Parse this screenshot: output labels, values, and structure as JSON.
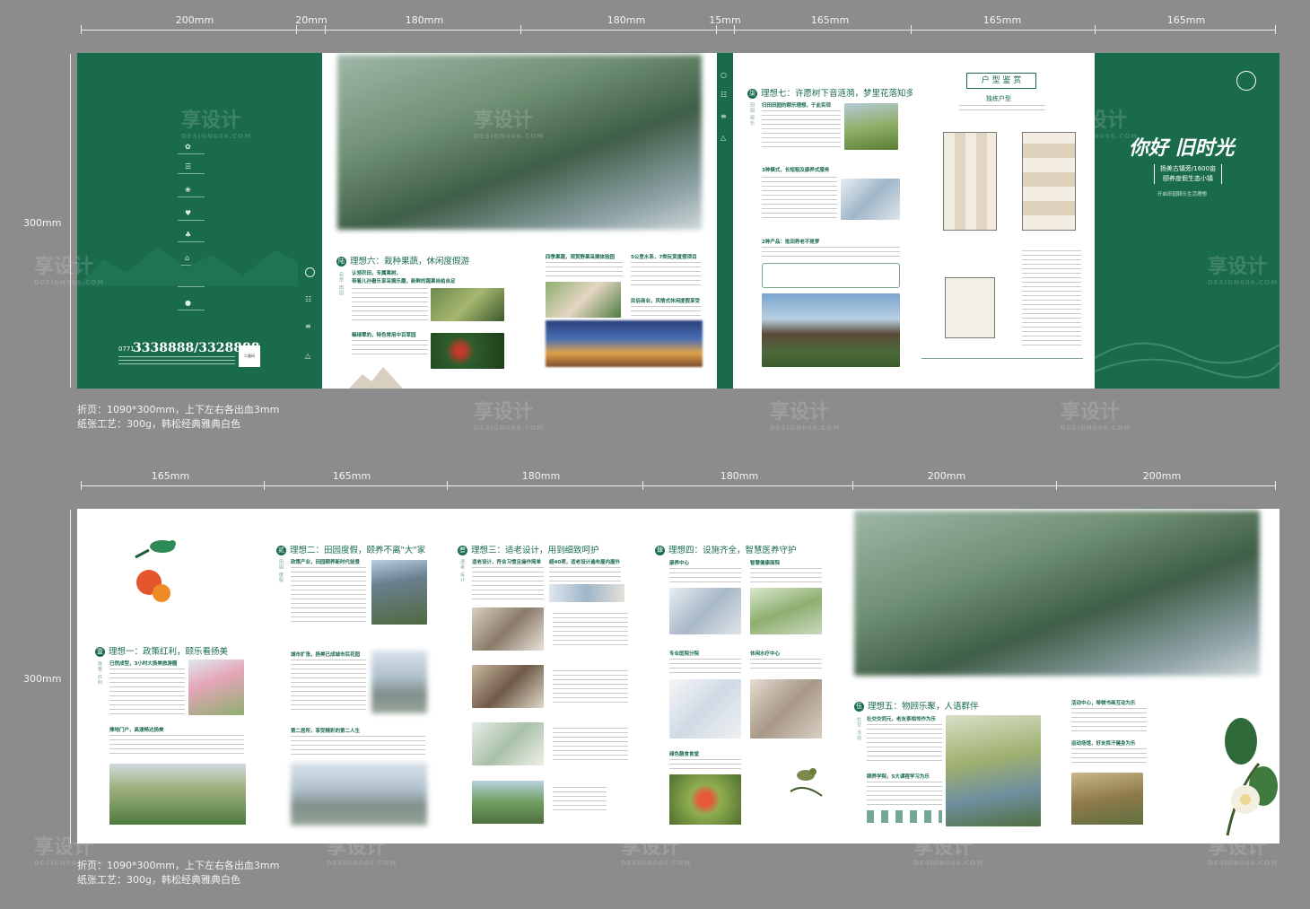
{
  "top_row": {
    "widths": [
      "200mm",
      "20mm",
      "180mm",
      "180mm",
      "15mm",
      "165mm",
      "165mm",
      "165mm"
    ],
    "height": "300mm",
    "note_fold": "折页：1090*300mm，上下左右各出血3mm",
    "note_paper": "纸张工艺：300g，韩松经典雅典白色"
  },
  "bottom_row": {
    "widths": [
      "165mm",
      "165mm",
      "180mm",
      "180mm",
      "200mm",
      "200mm"
    ],
    "height": "300mm",
    "note_fold": "折页：1090*300mm，上下左右各出血3mm",
    "note_paper": "纸张工艺：300g，韩松经典雅典白色"
  },
  "back_cover": {
    "phone": "3338888/3328888",
    "phone_prefix": "0771",
    "qr_label": "二维码"
  },
  "front_cover": {
    "headline": "你好 旧时光",
    "subline_1": "扬美古镇旁/1600亩",
    "subline_2": "颐养度假生态小镇",
    "tagline": "开启田园颐乐生活理想"
  },
  "sections": {
    "ideal6": "理想六：栽种果蔬，休闲度假游",
    "ideal6_sub1": "认领农田，专属果树，",
    "ideal6_sub1b": "带着儿孙看乐享采摘乐趣，新鲜的蔬果自给自足",
    "ideal6_sub2": "嘛绿翠的，特色常用中百草园",
    "ideal6_col2_a": "四季果蔬，观赏野果采摘体验园",
    "ideal6_col2_b": "民俗商业，风情式休闲度假享受",
    "ideal6_col3": "5公里水系，7类玩赏度假项目",
    "ideal7": "理想七：许愿树下音涟漪，梦里花落知多少",
    "ideal7_sub1": "归田田园的颐乐理想，于此实现",
    "ideal7_sub2": "3种模式，长短租及康养式服务",
    "ideal7_sub3": "2种产品：批田养老不是梦",
    "floorplan_title": "户 型 鉴 赏",
    "floorplan_sub": "独栋户型",
    "ideal1": "理想一：政策红利，颐乐看扬美",
    "ideal1_sub1": "已然成型，3小时大扬美旅游圈",
    "ideal1_sub2": "捧地门户，高速畅达扬美",
    "ideal2": "理想二：田园度假，颐养不离\"大\"家",
    "ideal2_sub1": "政策产业，田园颐养新时代前景",
    "ideal2_sub2": "城市扩张，扬美已成城市后花园",
    "ideal2_sub3": "第二居所，享受精彩的第二人生",
    "ideal3": "理想三：适老设计，用到细致呵护",
    "ideal3_sub1": "适老设计，符合习惯且操作简单",
    "ideal3_sub2": "超40项，适老设计遍布屋内屋外",
    "ideal4": "理想四：设施齐全，智慧医养守护",
    "ideal4_sub1": "康养中心",
    "ideal4_sub2": "智慧健康面院",
    "ideal4_sub3": "专业医院分院",
    "ideal4_sub4": "休闲水疗中心",
    "ideal4_sub5": "绿色膳食食堂",
    "ideal5": "理想五：物顾乐聚，人语群伴",
    "ideal5_sub1": "社交交同元，老友茶相邻作为乐",
    "ideal5_sub2": "颐养学院，5大课程学习为乐",
    "ideal5_sub3": "活动中心，琴棋书画互动为乐",
    "ideal5_sub4": "运动场馆，好友挥汗健身为乐"
  },
  "watermark": {
    "cn": "享设计",
    "en": "DESIGN006.COM"
  },
  "colors": {
    "brand_green": "#1a6b4c",
    "background": "#8c8c8c"
  }
}
